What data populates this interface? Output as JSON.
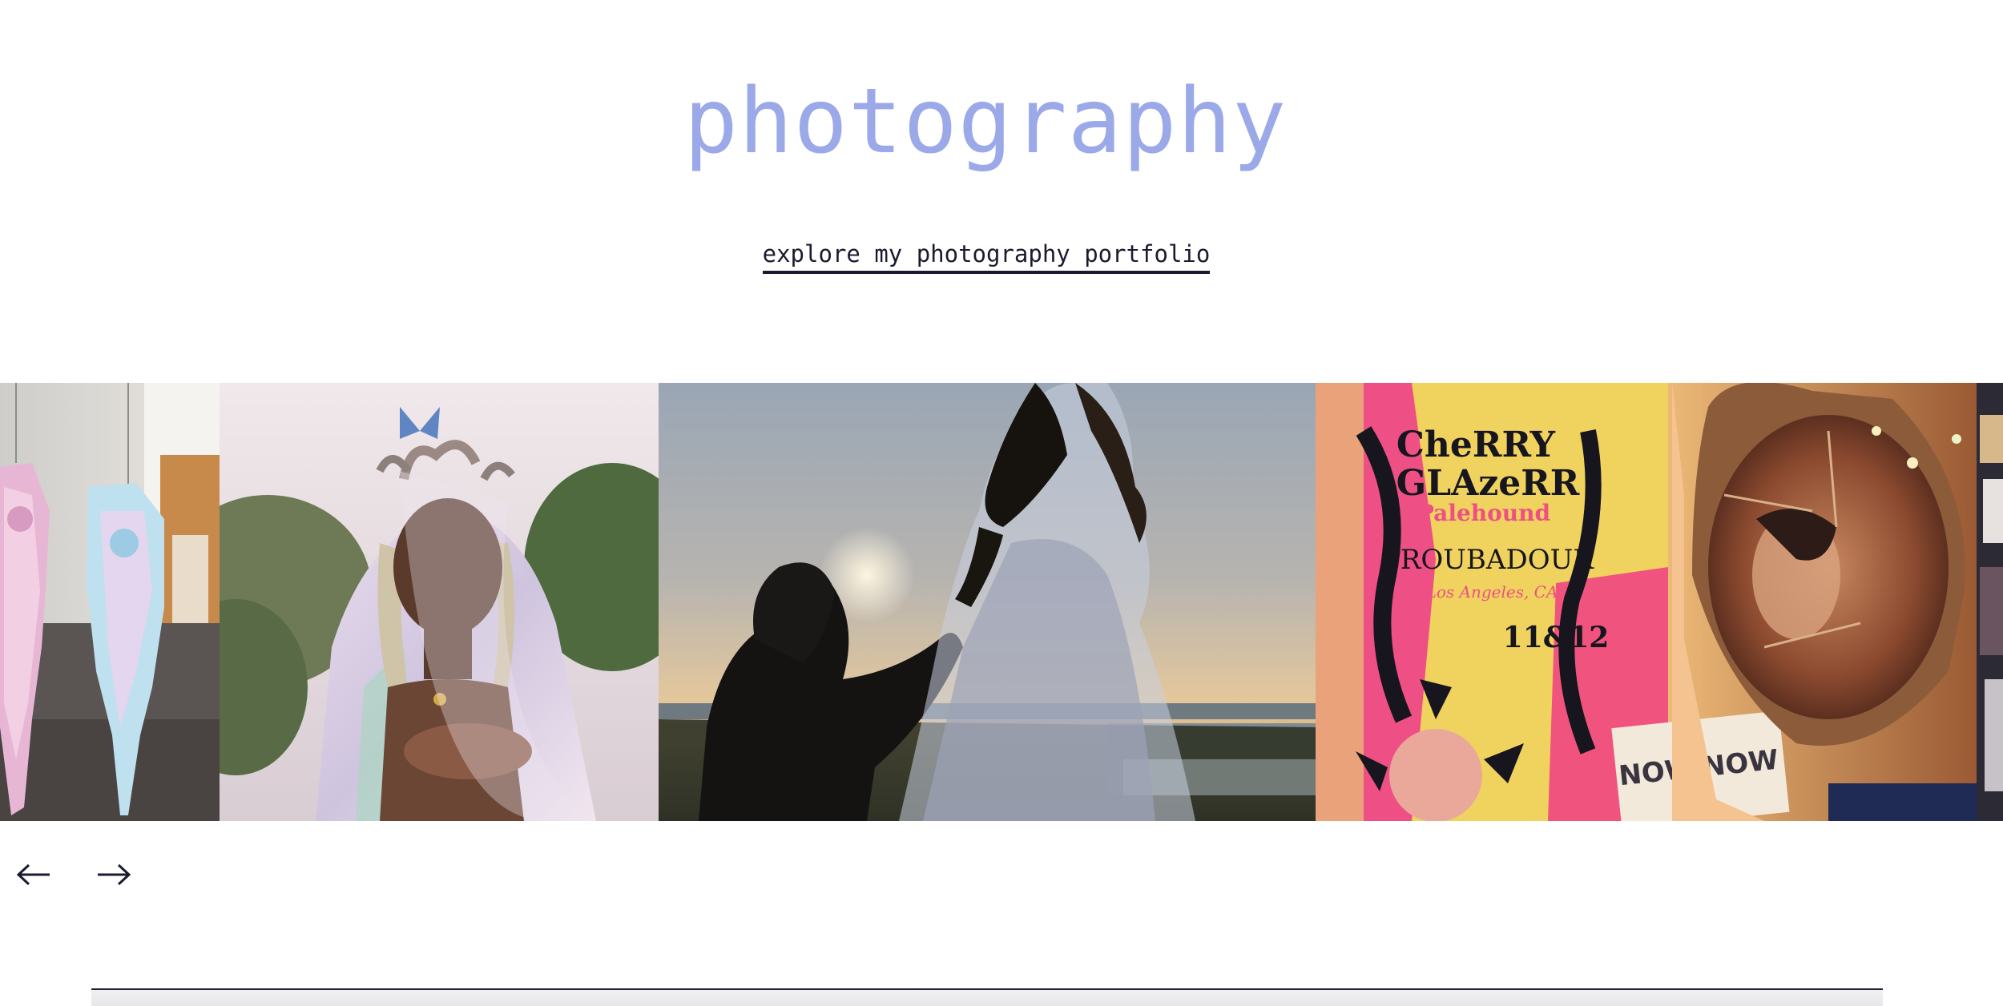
{
  "section": {
    "title": "photography",
    "link_label": "explore my photography portfolio"
  },
  "colors": {
    "title": "#9ba9e9",
    "text": "#1b1b2f",
    "divider": "#1f2137"
  },
  "carousel": {
    "slides": [
      {
        "name": "gallery-installation-photo",
        "tone": "hanging pastel textile sculptures in a gallery"
      },
      {
        "name": "veiled-portrait-photo",
        "tone": "portrait in iridescent veil blowing a kiss"
      },
      {
        "name": "sunset-proposal-photo",
        "tone": "silhouetted couple at sunset by the water"
      },
      {
        "name": "concert-poster-mirror-photo",
        "tone": "concert poster next to a mirror reflection"
      },
      {
        "name": "partial-next-photo",
        "tone": "partially visible next slide"
      }
    ],
    "poster_text": {
      "headliner": "CheRRY GLAZeRR",
      "support": "Palehound",
      "venue": "TROUBADOUR",
      "city": "Los Angeles, CA",
      "dates": "11&12",
      "sign": "NOW,NOW"
    },
    "prev_icon": "arrow-left-icon",
    "next_icon": "arrow-right-icon"
  }
}
